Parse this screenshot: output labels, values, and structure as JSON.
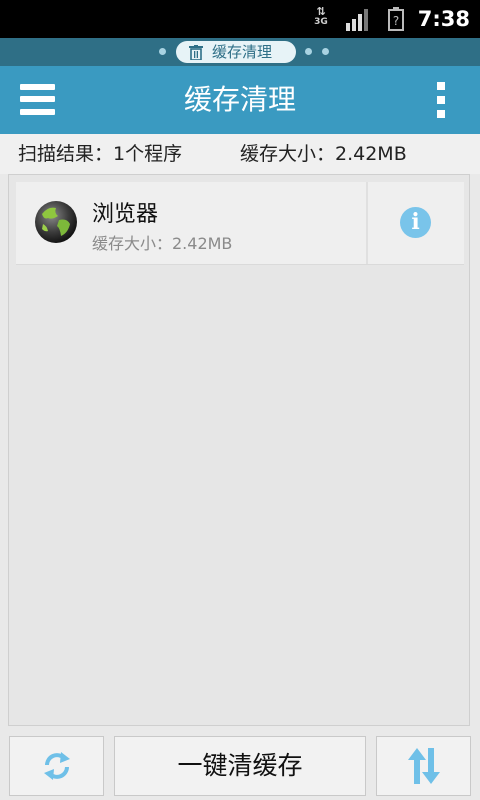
{
  "status_bar": {
    "network": "3G",
    "time": "7:38"
  },
  "page_indicator": {
    "current_page_label": "缓存清理"
  },
  "app_bar": {
    "title": "缓存清理"
  },
  "summary": {
    "scan_result": "扫描结果：1个程序",
    "cache_size": "缓存大小：2.42MB"
  },
  "list": {
    "items": [
      {
        "name": "浏览器",
        "size": "缓存大小：2.42MB",
        "icon": "globe-icon"
      }
    ]
  },
  "bottom_bar": {
    "refresh_icon": "refresh-icon",
    "clean_label": "一键清缓存",
    "sort_icon": "sort-icon"
  },
  "colors": {
    "app_bar": "#3a9ac1",
    "page_indicator": "#2f6f86",
    "info_icon": "#79c4ea"
  }
}
